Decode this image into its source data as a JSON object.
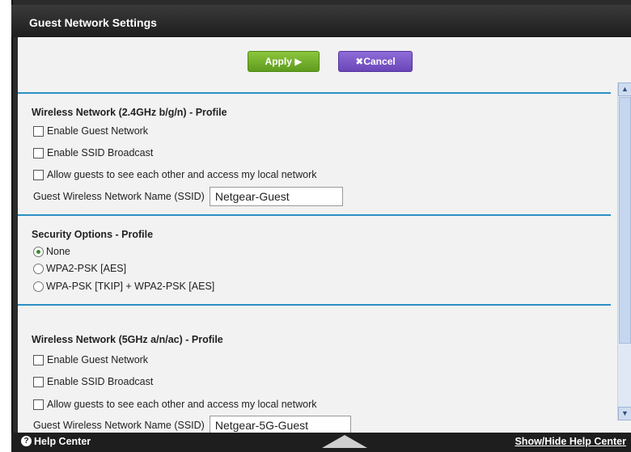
{
  "header": {
    "title": "Guest Network Settings"
  },
  "toolbar": {
    "apply_label": "Apply ▶",
    "cancel_label": "Cancel",
    "cancel_icon": "x-icon"
  },
  "wireless_24": {
    "title": "Wireless Network (2.4GHz b/g/n) - Profile",
    "enable_guest": "Enable Guest Network",
    "enable_ssid": "Enable SSID Broadcast",
    "allow_local": "Allow guests to see each other and access my local network",
    "ssid_label": "Guest Wireless Network Name (SSID)",
    "ssid_value": "Netgear-Guest"
  },
  "security": {
    "title": "Security Options - Profile",
    "options": [
      "None",
      "WPA2-PSK [AES]",
      "WPA-PSK [TKIP] + WPA2-PSK [AES]"
    ],
    "selected": "None"
  },
  "wireless_5": {
    "title": "Wireless Network (5GHz a/n/ac) - Profile",
    "enable_guest": "Enable Guest Network",
    "enable_ssid": "Enable SSID Broadcast",
    "allow_local": "Allow guests to see each other and access my local network",
    "ssid_label": "Guest Wireless Network Name (SSID)",
    "ssid_value": "Netgear-5G-Guest"
  },
  "footer": {
    "help_label": "Help Center",
    "show_hide_label": "Show/Hide Help Center"
  },
  "colors": {
    "apply_green": "#6fae28",
    "cancel_purple": "#7b56c8",
    "rule_blue": "#2c8fc5"
  }
}
